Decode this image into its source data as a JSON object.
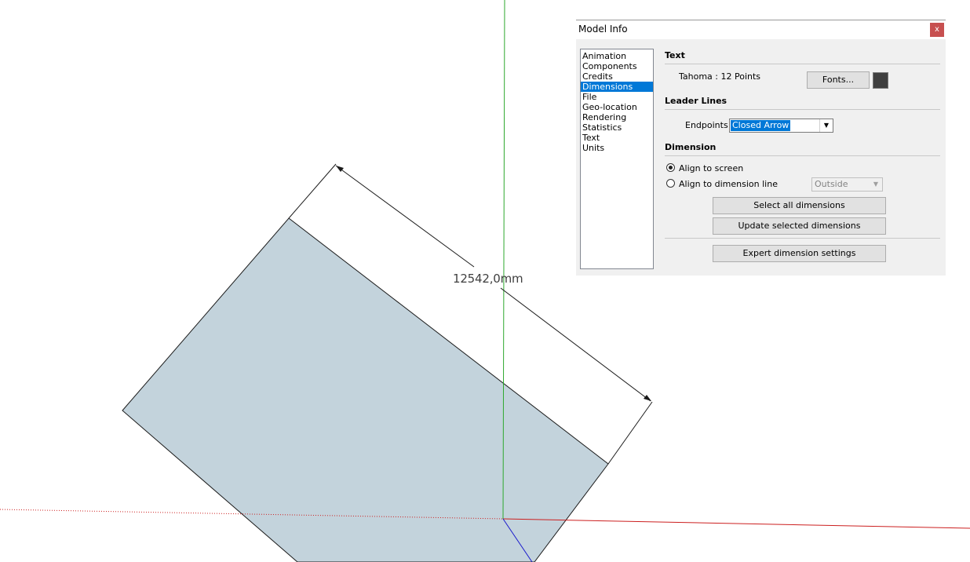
{
  "viewport": {
    "dimension_label": "12542,0mm",
    "colors": {
      "face": "#c3d3dc",
      "green_axis": "#2ea82e",
      "red_axis": "#cc1f1f",
      "blue_axis": "#1a1acc",
      "edge": "#1a1a1a"
    }
  },
  "dialog": {
    "title": "Model Info",
    "close_label": "x",
    "nav": {
      "items": [
        "Animation",
        "Components",
        "Credits",
        "Dimensions",
        "File",
        "Geo-location",
        "Rendering",
        "Statistics",
        "Text",
        "Units"
      ],
      "selected": "Dimensions"
    },
    "text_section": {
      "title": "Text",
      "font_info": "Tahoma : 12 Points",
      "fonts_button": "Fonts...",
      "color": "#3f3f3f"
    },
    "leader_section": {
      "title": "Leader Lines",
      "endpoints_label": "Endpoints:",
      "endpoints_value": "Closed Arrow"
    },
    "dimension_section": {
      "title": "Dimension",
      "align_screen": "Align to screen",
      "align_line": "Align to dimension line",
      "align_screen_checked": true,
      "position_value": "Outside",
      "select_all_button": "Select all dimensions",
      "update_button": "Update selected dimensions",
      "expert_button": "Expert dimension settings"
    }
  }
}
